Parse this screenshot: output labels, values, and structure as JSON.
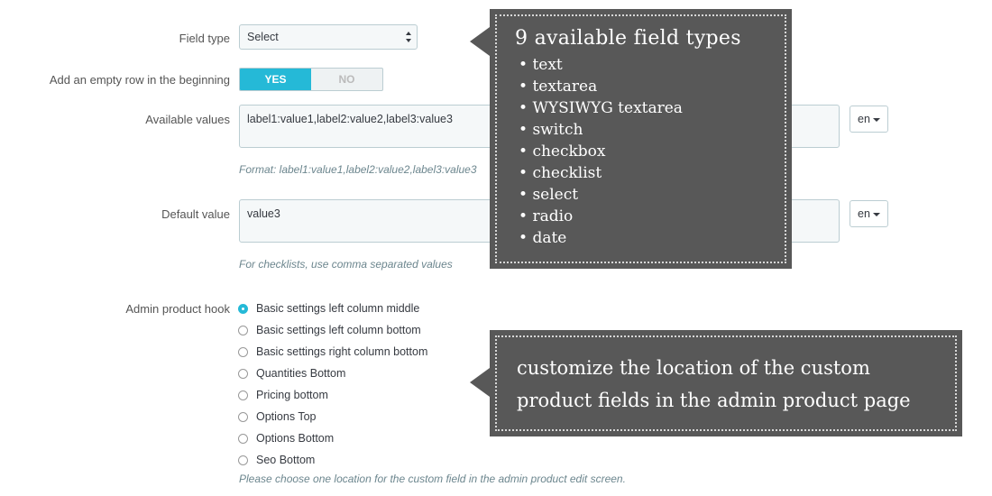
{
  "field_type": {
    "label": "Field type",
    "value": "Select"
  },
  "empty_row": {
    "label": "Add an empty row in the beginning",
    "yes_label": "YES",
    "no_label": "NO",
    "selected": "YES"
  },
  "available_values": {
    "label": "Available values",
    "value": "label1:value1,label2:value2,label3:value3",
    "help": "Format: label1:value1,label2:value2,label3:value3",
    "lang": "en"
  },
  "default_value": {
    "label": "Default value",
    "value": "value3",
    "help": "For checklists, use comma separated values",
    "lang": "en"
  },
  "admin_hook": {
    "label": "Admin product hook",
    "options": [
      {
        "label": "Basic settings left column middle",
        "checked": true
      },
      {
        "label": "Basic settings left column bottom",
        "checked": false
      },
      {
        "label": "Basic settings right column bottom",
        "checked": false
      },
      {
        "label": "Quantities Bottom",
        "checked": false
      },
      {
        "label": "Pricing bottom",
        "checked": false
      },
      {
        "label": "Options Top",
        "checked": false
      },
      {
        "label": "Options Bottom",
        "checked": false
      },
      {
        "label": "Seo Bottom",
        "checked": false
      }
    ],
    "help": "Please choose one location for the custom field in the admin product edit screen."
  },
  "callout_types": {
    "title": "9 available field types",
    "items": [
      "text",
      "textarea",
      "WYSIWYG textarea",
      "switch",
      "checkbox",
      "checklist",
      "select",
      "radio",
      "date"
    ]
  },
  "callout_location": {
    "text": "customize the location of  the custom\nproduct fields in the admin product page"
  },
  "colors": {
    "accent": "#25b9d7",
    "callout_bg": "#585858"
  }
}
